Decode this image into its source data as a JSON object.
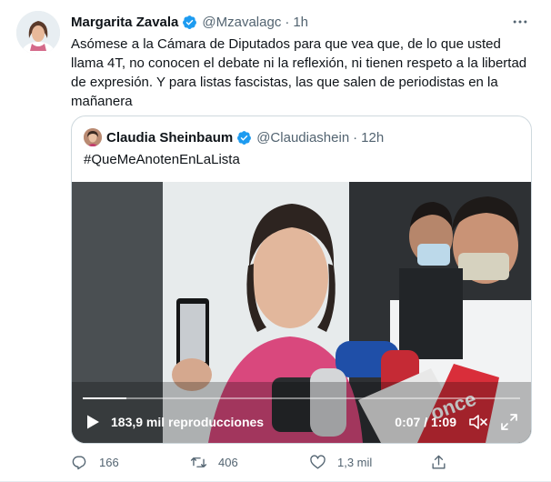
{
  "tweet": {
    "author_name": "Margarita Zavala",
    "handle": "@Mzavalagc",
    "separator": "·",
    "time": "1h",
    "text": "Asómese a la Cámara de Diputados para que vea que, de lo que usted llama 4T, no conocen el debate ni la reflexión, ni tienen respeto a la libertad de expresión. Y para listas fascistas, las que salen de periodistas en la mañanera"
  },
  "quoted_tweet": {
    "author_name": "Claudia Sheinbaum",
    "handle": "@Claudiashein",
    "separator": "·",
    "time": "12h",
    "text": "#QueMeAnotenEnLaLista",
    "video": {
      "views": "183,9 mil reproducciones",
      "timecode": "0:07 / 1:09",
      "progress_fraction": 0.1,
      "overlay_logo_text": "once"
    }
  },
  "actions": {
    "reply_count": "166",
    "retweet_count": "406",
    "like_count": "1,3 mil"
  },
  "colors": {
    "verified_badge": "#1d9bf0",
    "secondary_text": "#536471",
    "border": "#cfd9de"
  },
  "icons": [
    "verified-badge-icon",
    "more-icon",
    "play-icon",
    "mute-icon",
    "fullscreen-icon",
    "reply-icon",
    "retweet-icon",
    "like-icon",
    "share-icon"
  ]
}
